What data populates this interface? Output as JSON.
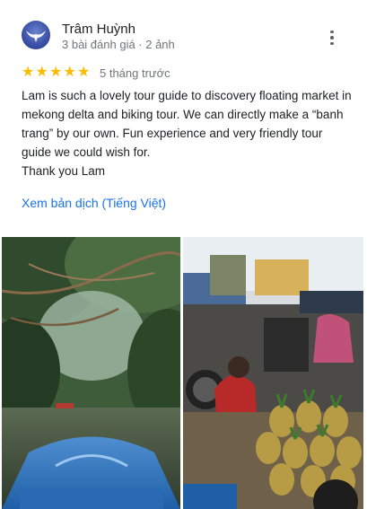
{
  "reviewer": {
    "name": "Trâm Huỳnh",
    "meta": "3 bài đánh giá · 2 ảnh",
    "avatar_icon": "bird-avatar-icon"
  },
  "menu": {
    "icon": "more-vert-icon"
  },
  "rating": {
    "stars": 5,
    "max": 5,
    "star_color": "#fbbc04",
    "time_ago": "5 tháng trước"
  },
  "review": {
    "paragraph": "Lam is such a lovely tour guide to discovery floating market in mekong delta and biking tour. We can directly make a “banh trang” by our own. Fun experience and very friendly tour guide we could wish for.",
    "closing": "Thank you Lam"
  },
  "translate_link": {
    "label": "Xem bản dịch (Tiếng Việt)",
    "color": "#1a73e8"
  },
  "photos": [
    {
      "name": "river-boat-photo"
    },
    {
      "name": "floating-market-pineapple-photo"
    }
  ]
}
